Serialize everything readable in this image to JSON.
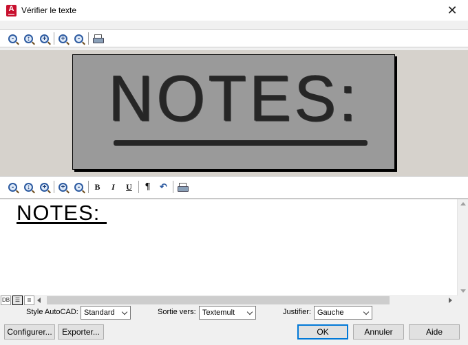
{
  "window": {
    "title": "Vérifier le texte",
    "app_icon_letter": "A",
    "close_glyph": "✕"
  },
  "toolbar_top": {
    "zoom_out": "-",
    "zoom_fit": "↕",
    "zoom_window": "+",
    "zoom_in": "+",
    "zoom_out_2": "-"
  },
  "preview": {
    "scanned_text": "NOTES:"
  },
  "toolbar_edit": {
    "zoom_out": "-",
    "zoom_fit": "↕",
    "zoom_window": "+",
    "zoom_in": "+",
    "zoom_out_2": "-",
    "bold": "B",
    "italic": "I",
    "underline": "U",
    "paragraph": "¶",
    "undo": "↶"
  },
  "editor": {
    "text": "NOTES: "
  },
  "view_modes": [
    "DB",
    "☰",
    "≣"
  ],
  "options": {
    "style_label": "Style AutoCAD:",
    "style_value": "Standard",
    "output_label": "Sortie vers:",
    "output_value": "Textemult",
    "justify_label": "Justifier:",
    "justify_value": "Gauche"
  },
  "buttons": {
    "configure": "Configurer...",
    "export": "Exporter...",
    "ok": "OK",
    "cancel": "Annuler",
    "help": "Aide"
  },
  "colors": {
    "accent": "#0078d7",
    "app_icon": "#c8102e",
    "preview_bg": "#d6d2cc",
    "scan_bg": "#9a9a9a"
  }
}
